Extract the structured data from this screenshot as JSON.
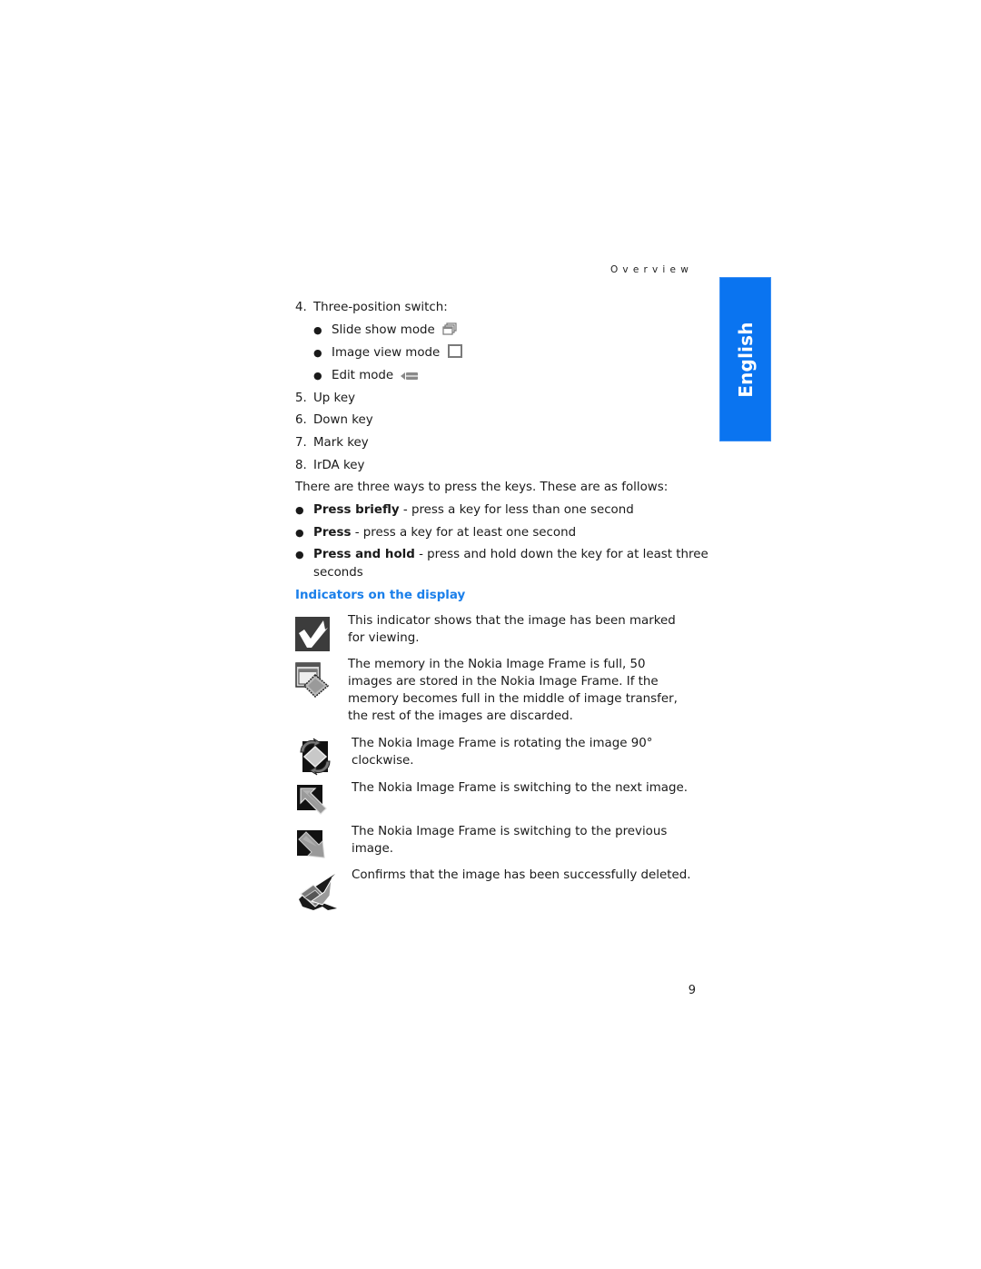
{
  "header": {
    "running_head": "Overview",
    "language_tab": "English"
  },
  "switch_list": {
    "item_number": "4.",
    "item_label": "Three-position switch:",
    "modes": [
      {
        "label": "Slide show mode",
        "icon": "slide-show-mode-icon"
      },
      {
        "label": "Image view mode",
        "icon": "image-view-mode-icon"
      },
      {
        "label": "Edit mode",
        "icon": "edit-mode-icon"
      }
    ]
  },
  "key_list": [
    {
      "number": "5.",
      "label": "Up key"
    },
    {
      "number": "6.",
      "label": "Down key"
    },
    {
      "number": "7.",
      "label": "Mark key"
    },
    {
      "number": "8.",
      "label": "IrDA key"
    }
  ],
  "press_intro": "There are three ways to press the keys. These are as follows:",
  "press_types": [
    {
      "term": "Press briefly",
      "description": " - press a key for less than one second"
    },
    {
      "term": "Press",
      "description": " - press a key for at least one second"
    },
    {
      "term": "Press and hold",
      "description": " - press and hold down the key for at least three",
      "continuation": "seconds"
    }
  ],
  "indicators": {
    "heading": "Indicators on the display",
    "accent_color": "#1a7fea",
    "items": [
      {
        "icon": "marked-checkmark-icon",
        "text": "This indicator shows that the image has been marked for viewing."
      },
      {
        "icon": "memory-full-icon",
        "text": "The memory in the Nokia Image Frame is full, 50 images are stored in the Nokia Image Frame. If the memory becomes full in the middle of image transfer, the rest of the images are discarded."
      },
      {
        "icon": "rotate-icon",
        "text": "The Nokia Image Frame is rotating the image 90° clockwise."
      },
      {
        "icon": "next-image-icon",
        "text": "The Nokia Image Frame is switching to the next image."
      },
      {
        "icon": "previous-image-icon",
        "text": "The Nokia Image Frame is switching to the previous image."
      },
      {
        "icon": "deleted-icon",
        "text": "Confirms that the image has been successfully deleted."
      }
    ]
  },
  "footer": {
    "page_number": "9"
  },
  "colors": {
    "language_tab_bg": "#0a74f0",
    "heading_blue": "#1a7fea"
  }
}
